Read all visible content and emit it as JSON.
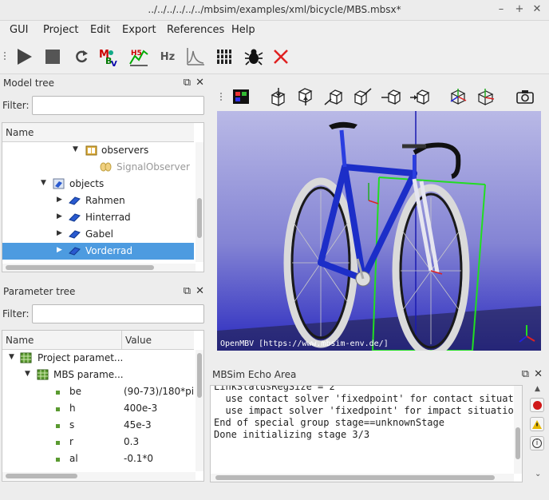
{
  "window": {
    "title": "../../../../../../mbsim/examples/xml/bicycle/MBS.mbsx*"
  },
  "menu": [
    "GUI",
    "Project",
    "Edit",
    "Export",
    "References",
    "Help"
  ],
  "toolbar": {
    "hz_label": "Hz"
  },
  "model_tree": {
    "title": "Model tree",
    "filter_label": "Filter:",
    "filter_value": "",
    "column": "Name",
    "rows": [
      {
        "label": "observers",
        "icon": "folder-icon",
        "expanded": true
      },
      {
        "label": "SignalObserver",
        "icon": "observer-icon",
        "disabled": true
      },
      {
        "label": "objects",
        "icon": "objects-icon",
        "expanded": true
      },
      {
        "label": "Rahmen",
        "icon": "body-icon"
      },
      {
        "label": "Hinterrad",
        "icon": "body-icon"
      },
      {
        "label": "Gabel",
        "icon": "body-icon"
      },
      {
        "label": "Vorderrad",
        "icon": "body-icon",
        "selected": true
      }
    ]
  },
  "parameter_tree": {
    "title": "Parameter tree",
    "filter_label": "Filter:",
    "filter_value": "",
    "col_name": "Name",
    "col_value": "Value",
    "rows": [
      {
        "name": "Project paramet...",
        "value": ""
      },
      {
        "name": "MBS parame...",
        "value": ""
      },
      {
        "name": "be",
        "value": "(90-73)/180*pi"
      },
      {
        "name": "h",
        "value": "400e-3"
      },
      {
        "name": "s",
        "value": "45e-3"
      },
      {
        "name": "r",
        "value": "0.3"
      },
      {
        "name": "al",
        "value": "-0.1*0"
      }
    ]
  },
  "viewer": {
    "watermark": "OpenMBV [https://www.mbsim-env.de/]"
  },
  "echo": {
    "title": "MBSim Echo Area",
    "lines": [
      "LinkStatusRegSize = 2",
      "  use contact solver 'fixedpoint' for contact situat",
      "  use impact solver 'fixedpoint' for impact situatio",
      "End of special group stage==unknownStage",
      "Done initializing stage 3/3"
    ]
  },
  "colors": {
    "selection": "#4d9be0",
    "scene_top": "#b9b9e6",
    "scene_bottom": "#2b2bbf"
  }
}
